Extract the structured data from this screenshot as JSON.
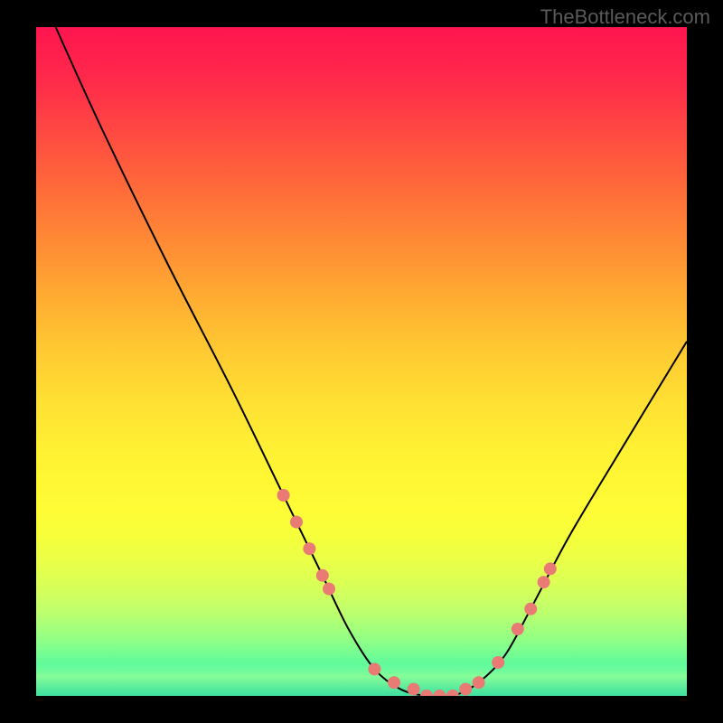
{
  "watermark": "TheBottleneck.com",
  "chart_data": {
    "type": "line",
    "title": "",
    "xlabel": "",
    "ylabel": "",
    "xlim": [
      0,
      100
    ],
    "ylim": [
      0,
      100
    ],
    "series": [
      {
        "name": "curve",
        "x": [
          3,
          10,
          20,
          30,
          38,
          44,
          48,
          52,
          56,
          60,
          64,
          68,
          72,
          76,
          82,
          90,
          100
        ],
        "y": [
          100,
          85,
          65,
          46,
          30,
          18,
          10,
          4,
          1,
          0,
          0,
          2,
          6,
          13,
          24,
          37,
          53
        ]
      }
    ],
    "highlight_dots": {
      "x": [
        38,
        40,
        42,
        44,
        45,
        52,
        55,
        58,
        60,
        62,
        64,
        66,
        68,
        71,
        74,
        76,
        78,
        79
      ],
      "y": [
        30,
        26,
        22,
        18,
        16,
        4,
        2,
        1,
        0,
        0,
        0,
        1,
        2,
        5,
        10,
        13,
        17,
        19
      ]
    },
    "background": "vertical gradient red→yellow→green"
  }
}
